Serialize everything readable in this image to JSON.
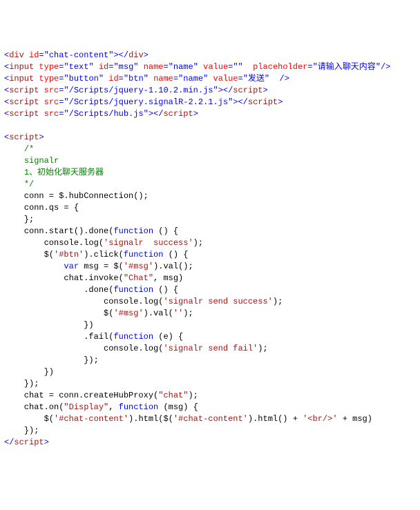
{
  "lines": [
    [
      [
        "tag",
        "<"
      ],
      [
        "name",
        "div"
      ],
      [
        "plain",
        " "
      ],
      [
        "attr",
        "id"
      ],
      [
        "tag",
        "="
      ],
      [
        "val",
        "\"chat-content\""
      ],
      [
        "tag",
        "></"
      ],
      [
        "name",
        "div"
      ],
      [
        "tag",
        ">"
      ]
    ],
    [
      [
        "tag",
        "<"
      ],
      [
        "name",
        "input"
      ],
      [
        "plain",
        " "
      ],
      [
        "attr",
        "type"
      ],
      [
        "tag",
        "="
      ],
      [
        "val",
        "\"text\""
      ],
      [
        "plain",
        " "
      ],
      [
        "attr",
        "id"
      ],
      [
        "tag",
        "="
      ],
      [
        "val",
        "\"msg\""
      ],
      [
        "plain",
        " "
      ],
      [
        "attr",
        "name"
      ],
      [
        "tag",
        "="
      ],
      [
        "val",
        "\"name\""
      ],
      [
        "plain",
        " "
      ],
      [
        "attr",
        "value"
      ],
      [
        "tag",
        "="
      ],
      [
        "val",
        "\"\""
      ],
      [
        "plain",
        "  "
      ],
      [
        "attr",
        "placeholder"
      ],
      [
        "tag",
        "="
      ],
      [
        "val",
        "\"请输入聊天内容\""
      ],
      [
        "tag",
        "/>"
      ]
    ],
    [
      [
        "tag",
        "<"
      ],
      [
        "name",
        "input"
      ],
      [
        "plain",
        " "
      ],
      [
        "attr",
        "type"
      ],
      [
        "tag",
        "="
      ],
      [
        "val",
        "\"button\""
      ],
      [
        "plain",
        " "
      ],
      [
        "attr",
        "id"
      ],
      [
        "tag",
        "="
      ],
      [
        "val",
        "\"btn\""
      ],
      [
        "plain",
        " "
      ],
      [
        "attr",
        "name"
      ],
      [
        "tag",
        "="
      ],
      [
        "val",
        "\"name\""
      ],
      [
        "plain",
        " "
      ],
      [
        "attr",
        "value"
      ],
      [
        "tag",
        "="
      ],
      [
        "val",
        "\"发送\""
      ],
      [
        "plain",
        "  "
      ],
      [
        "tag",
        "/>"
      ]
    ],
    [
      [
        "tag",
        "<"
      ],
      [
        "name",
        "script"
      ],
      [
        "plain",
        " "
      ],
      [
        "attr",
        "src"
      ],
      [
        "tag",
        "="
      ],
      [
        "val",
        "\"/Scripts/jquery-1.10.2.min.js\""
      ],
      [
        "tag",
        "></"
      ],
      [
        "name",
        "script"
      ],
      [
        "tag",
        ">"
      ]
    ],
    [
      [
        "tag",
        "<"
      ],
      [
        "name",
        "script"
      ],
      [
        "plain",
        " "
      ],
      [
        "attr",
        "src"
      ],
      [
        "tag",
        "="
      ],
      [
        "val",
        "\"/Scripts/jquery.signalR-2.2.1.js\""
      ],
      [
        "tag",
        "></"
      ],
      [
        "name",
        "script"
      ],
      [
        "tag",
        ">"
      ]
    ],
    [
      [
        "tag",
        "<"
      ],
      [
        "name",
        "script"
      ],
      [
        "plain",
        " "
      ],
      [
        "attr",
        "src"
      ],
      [
        "tag",
        "="
      ],
      [
        "val",
        "\"/Scripts/hub.js\""
      ],
      [
        "tag",
        "></"
      ],
      [
        "name",
        "script"
      ],
      [
        "tag",
        ">"
      ]
    ],
    [
      [
        "plain",
        ""
      ]
    ],
    [
      [
        "tag",
        "<"
      ],
      [
        "name",
        "script"
      ],
      [
        "tag",
        ">"
      ]
    ],
    [
      [
        "plain",
        "    "
      ],
      [
        "cmt",
        "/*"
      ]
    ],
    [
      [
        "plain",
        "    "
      ],
      [
        "cmt",
        "signalr"
      ]
    ],
    [
      [
        "plain",
        "    "
      ],
      [
        "cmt",
        "1、初始化聊天服务器"
      ]
    ],
    [
      [
        "plain",
        "    "
      ],
      [
        "cmt",
        "*/"
      ]
    ],
    [
      [
        "plain",
        "    conn = $.hubConnection();"
      ]
    ],
    [
      [
        "plain",
        "    conn.qs = {"
      ]
    ],
    [
      [
        "plain",
        "    };"
      ]
    ],
    [
      [
        "plain",
        "    conn.start().done("
      ],
      [
        "kw",
        "function"
      ],
      [
        "plain",
        " () {"
      ]
    ],
    [
      [
        "plain",
        "        console.log("
      ],
      [
        "str",
        "'signalr  success'"
      ],
      [
        "plain",
        ");"
      ]
    ],
    [
      [
        "plain",
        "        $("
      ],
      [
        "str",
        "'#btn'"
      ],
      [
        "plain",
        ").click("
      ],
      [
        "kw",
        "function"
      ],
      [
        "plain",
        " () {"
      ]
    ],
    [
      [
        "plain",
        "            "
      ],
      [
        "kw",
        "var"
      ],
      [
        "plain",
        " msg = $("
      ],
      [
        "str",
        "'#msg'"
      ],
      [
        "plain",
        ").val();"
      ]
    ],
    [
      [
        "plain",
        "            chat.invoke("
      ],
      [
        "str",
        "\"Chat\""
      ],
      [
        "plain",
        ", msg)"
      ]
    ],
    [
      [
        "plain",
        "                .done("
      ],
      [
        "kw",
        "function"
      ],
      [
        "plain",
        " () {"
      ]
    ],
    [
      [
        "plain",
        "                    console.log("
      ],
      [
        "str",
        "'signalr send success'"
      ],
      [
        "plain",
        ");"
      ]
    ],
    [
      [
        "plain",
        "                    $("
      ],
      [
        "str",
        "'#msg'"
      ],
      [
        "plain",
        ").val("
      ],
      [
        "str",
        "''"
      ],
      [
        "plain",
        ");"
      ]
    ],
    [
      [
        "plain",
        "                })"
      ]
    ],
    [
      [
        "plain",
        "                .fail("
      ],
      [
        "kw",
        "function"
      ],
      [
        "plain",
        " (e) {"
      ]
    ],
    [
      [
        "plain",
        "                    console.log("
      ],
      [
        "str",
        "'signalr send fail'"
      ],
      [
        "plain",
        ");"
      ]
    ],
    [
      [
        "plain",
        "                });"
      ]
    ],
    [
      [
        "plain",
        "        })"
      ]
    ],
    [
      [
        "plain",
        "    });"
      ]
    ],
    [
      [
        "plain",
        "    chat = conn.createHubProxy("
      ],
      [
        "str",
        "\"chat\""
      ],
      [
        "plain",
        ");"
      ]
    ],
    [
      [
        "plain",
        "    chat.on("
      ],
      [
        "str",
        "\"Display\""
      ],
      [
        "plain",
        ", "
      ],
      [
        "kw",
        "function"
      ],
      [
        "plain",
        " (msg) {"
      ]
    ],
    [
      [
        "plain",
        "        $("
      ],
      [
        "str",
        "'#chat-content'"
      ],
      [
        "plain",
        ").html($("
      ],
      [
        "str",
        "'#chat-content'"
      ],
      [
        "plain",
        ").html() + "
      ],
      [
        "str",
        "'<br/>'"
      ],
      [
        "plain",
        " + msg)"
      ]
    ],
    [
      [
        "plain",
        "    });"
      ]
    ],
    [
      [
        "tag",
        "</"
      ],
      [
        "name",
        "script"
      ],
      [
        "tag",
        ">"
      ]
    ]
  ]
}
